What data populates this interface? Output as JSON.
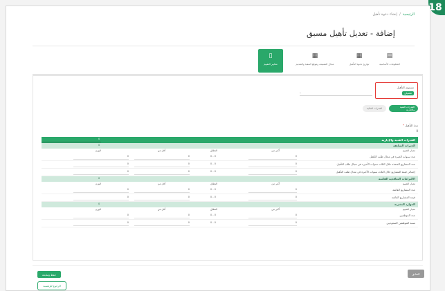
{
  "step_number": "18",
  "breadcrumb": {
    "home": "الرئيسية",
    "separator": "/",
    "current": "إنشاء دعوة تأهيل"
  },
  "page_title": "إضافة - تعديل تأهيل مسبق",
  "tabs": [
    {
      "label": "المعلومات الأساسية",
      "icon": "document-icon"
    },
    {
      "label": "تواريخ دعوة التأهيل",
      "icon": "calendar-icon"
    },
    {
      "label": "مجال التصنيف وموقع التنفيذ والتقديم",
      "icon": "grid-icon"
    },
    {
      "label": "معايير التقييم",
      "icon": "clipboard-icon"
    }
  ],
  "level": {
    "label": "مستوى التأهيل",
    "badge": "تفصيلي",
    "value": "-"
  },
  "filters": {
    "active": "القدرات الفنية والإدارية",
    "inactive": "القدرات المالية"
  },
  "period": {
    "label": "مدة التأهيل",
    "required_mark": "*",
    "value": "0"
  },
  "section": {
    "title": "القدرات الفنية والإدارية",
    "value": "0"
  },
  "columns": {
    "criteria": "معيار التقييم",
    "from": "أكبر من",
    "range": "النطاق",
    "to": "أقل من",
    "weight": "الوزن"
  },
  "groups": [
    {
      "title": "الخبرات السابقة",
      "value": "0",
      "items": [
        {
          "label": "عدد سنوات الخبرة في مجال طلب التأهيل",
          "from": "0",
          "range": "0 - 0",
          "to": "0",
          "weight": "0"
        },
        {
          "label": "عدد المشاريع المنفذة خلال الثلاث سنوات الأخيرة في مجال طلب التأهيل",
          "from": "0",
          "range": "0 - 0",
          "to": "0",
          "weight": "0"
        },
        {
          "label": "إجمالي قيمة المشاريع خلال الثلاث سنوات الأخيرة في مجال طلب التأهيل",
          "from": "0",
          "range": "0 - 0",
          "to": "0",
          "weight": "0"
        }
      ]
    },
    {
      "title": "الالتزامات التعاقدية القائمة",
      "value": "0",
      "items": [
        {
          "label": "عدد المشاريع القائمة",
          "from": "0",
          "range": "0 - 0",
          "to": "0",
          "weight": "0"
        },
        {
          "label": "قيمة المشاريع القائمة",
          "from": "0",
          "range": "0 - 0",
          "to": "0",
          "weight": "0"
        }
      ]
    },
    {
      "title": "الموارد البشرية",
      "value": "0",
      "items": [
        {
          "label": "عدد الموظفين",
          "from": "0",
          "range": "0 - 0",
          "to": "0",
          "weight": "0"
        },
        {
          "label": "نسبة الموظفين السعوديين",
          "from": "0",
          "range": "0 - 0",
          "to": "0",
          "weight": "0"
        }
      ]
    }
  ],
  "buttons": {
    "save": "حفظ ومتابعة",
    "back": "الرجوع للرئيسية",
    "prev": "السابق"
  },
  "colors": {
    "primary": "#2aa86a",
    "light_band": "#cfe9dc",
    "highlight": "#e53935"
  }
}
